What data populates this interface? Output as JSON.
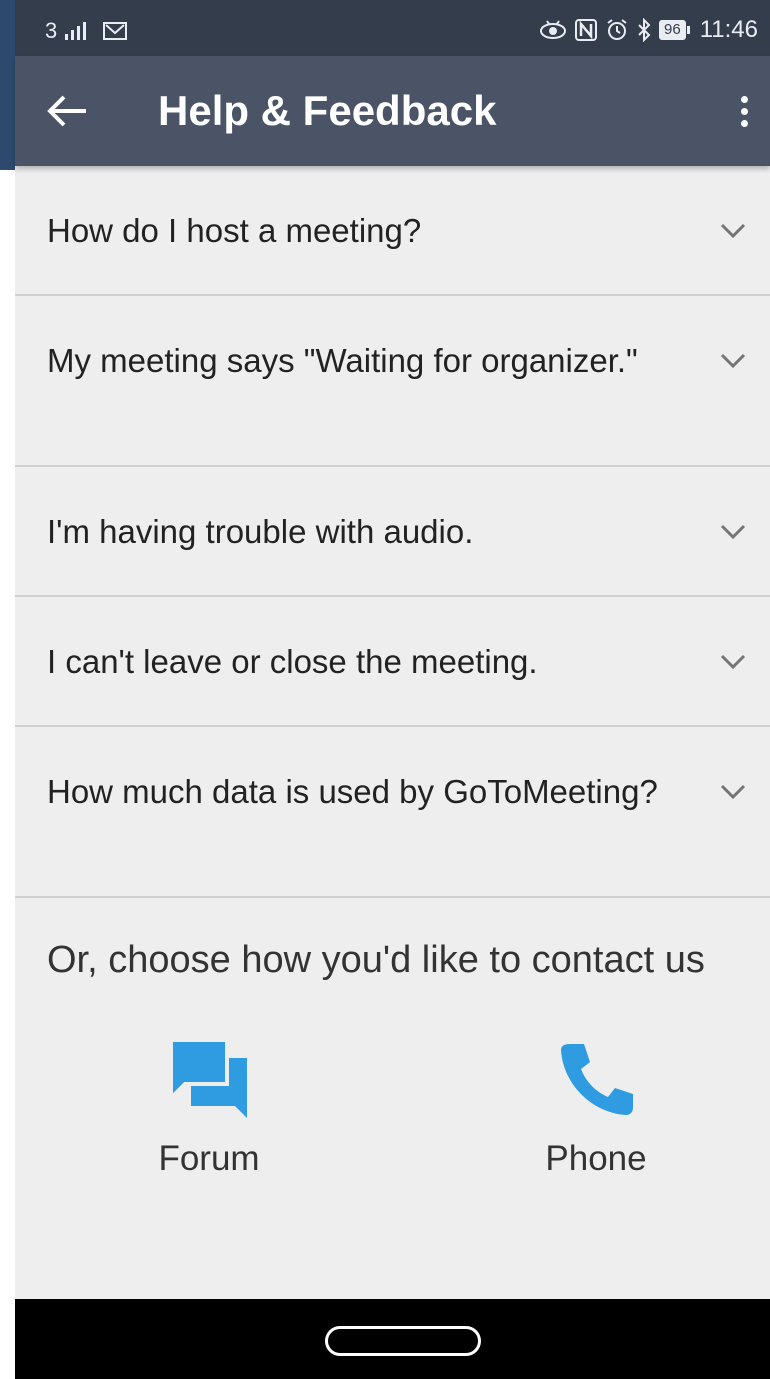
{
  "status_bar": {
    "network": "3",
    "battery": "96",
    "time": "11:46"
  },
  "toolbar": {
    "title": "Help & Feedback"
  },
  "faq": [
    {
      "question": "How do I host a meeting?"
    },
    {
      "question": "My meeting says \"Waiting for organizer.\""
    },
    {
      "question": "I'm having trouble with audio."
    },
    {
      "question": "I can't leave or close the meeting."
    },
    {
      "question": "How much data is used by GoToMeeting?"
    }
  ],
  "contact": {
    "title": "Or, choose how you'd like to contact us",
    "forum_label": "Forum",
    "phone_label": "Phone"
  },
  "colors": {
    "accent": "#2f9be0",
    "toolbar": "#4b5466",
    "status_bar": "#343d4c"
  }
}
